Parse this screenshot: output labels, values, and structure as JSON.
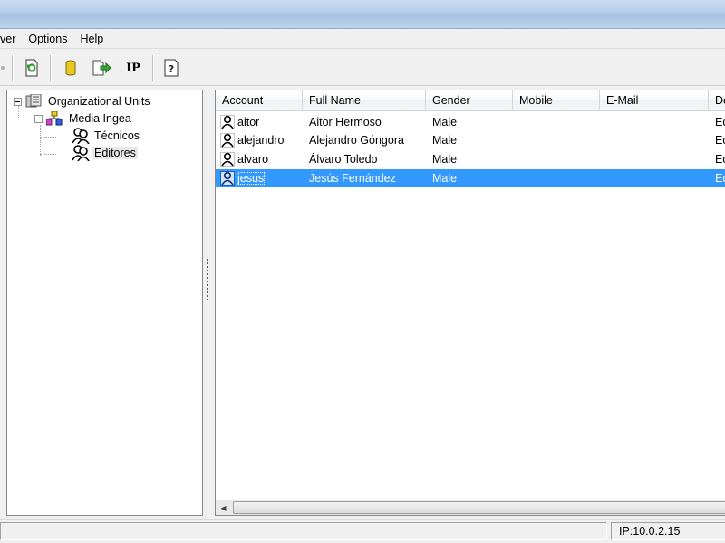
{
  "menu": {
    "items": [
      "ver",
      "Options",
      "Help"
    ]
  },
  "toolbar": {
    "buttons": [
      {
        "name": "refresh-icon"
      },
      {
        "name": "database-icon"
      },
      {
        "name": "export-icon"
      },
      {
        "name": "ip-icon",
        "label": "IP"
      },
      {
        "name": "help-icon",
        "label": "?"
      }
    ]
  },
  "tree": {
    "root": "Organizational Units",
    "org": "Media Ingea",
    "children": [
      "Técnicos",
      "Editores"
    ],
    "selected": "Editores"
  },
  "list": {
    "columns": [
      "Account",
      "Full Name",
      "Gender",
      "Mobile",
      "E-Mail",
      "De"
    ],
    "rows": [
      {
        "account": "aitor",
        "full_name": "Aitor Hermoso",
        "gender": "Male",
        "mobile": "",
        "email": "",
        "dept": "Ed"
      },
      {
        "account": "alejandro",
        "full_name": "Alejandro Góngora",
        "gender": "Male",
        "mobile": "",
        "email": "",
        "dept": "Ed"
      },
      {
        "account": "alvaro",
        "full_name": "Álvaro Toledo",
        "gender": "Male",
        "mobile": "",
        "email": "",
        "dept": "Ed"
      },
      {
        "account": "jesus",
        "full_name": "Jesús Fernández",
        "gender": "Male",
        "mobile": "",
        "email": "",
        "dept": "Ed"
      }
    ],
    "selected_row": 3
  },
  "status": {
    "ip": "IP:10.0.2.15"
  },
  "colors": {
    "selection": "#3399ff",
    "pane_border": "#828790"
  }
}
